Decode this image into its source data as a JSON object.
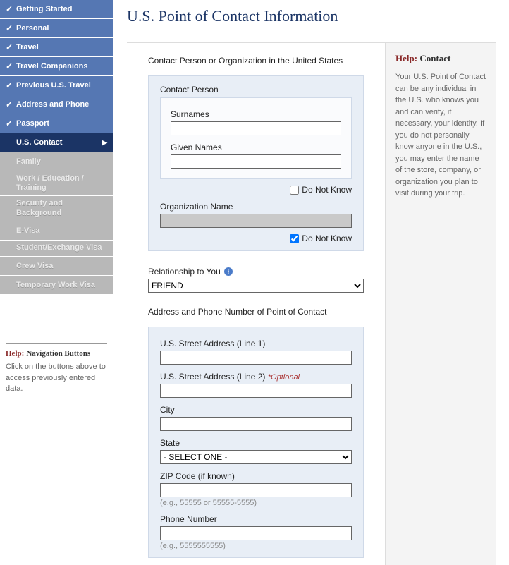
{
  "sidebar": {
    "items": [
      {
        "label": "Getting Started",
        "state": "done"
      },
      {
        "label": "Personal",
        "state": "done"
      },
      {
        "label": "Travel",
        "state": "done"
      },
      {
        "label": "Travel Companions",
        "state": "done"
      },
      {
        "label": "Previous U.S. Travel",
        "state": "done"
      },
      {
        "label": "Address and Phone",
        "state": "done"
      },
      {
        "label": "Passport",
        "state": "done"
      },
      {
        "label": "U.S. Contact",
        "state": "active"
      },
      {
        "label": "Family",
        "state": "future"
      },
      {
        "label": "Work / Education / Training",
        "state": "future"
      },
      {
        "label": "Security and Background",
        "state": "future"
      },
      {
        "label": "E-Visa",
        "state": "future"
      },
      {
        "label": "Student/Exchange Visa",
        "state": "future"
      },
      {
        "label": "Crew Visa",
        "state": "future"
      },
      {
        "label": "Temporary Work Visa",
        "state": "future"
      }
    ]
  },
  "page_title": "U.S. Point of Contact Information",
  "section1_heading": "Contact Person or Organization in the United States",
  "contact_person": {
    "box_title": "Contact Person",
    "surnames_label": "Surnames",
    "surnames_value": "",
    "given_label": "Given Names",
    "given_value": "",
    "dnk_label": "Do Not Know",
    "dnk_checked": false
  },
  "org": {
    "label": "Organization Name",
    "value": "",
    "dnk_label": "Do Not Know",
    "dnk_checked": true
  },
  "relationship": {
    "label": "Relationship to You",
    "value": "FRIEND"
  },
  "section2_heading": "Address and Phone Number of Point of Contact",
  "address": {
    "line1_label": "U.S. Street Address (Line 1)",
    "line1_value": "",
    "line2_label": "U.S. Street Address (Line 2)",
    "line2_optional": "*Optional",
    "line2_value": "",
    "city_label": "City",
    "city_value": "",
    "state_label": "State",
    "state_value": "- SELECT ONE -",
    "zip_label": "ZIP Code (if known)",
    "zip_value": "",
    "zip_hint": "(e.g., 55555 or 55555-5555)",
    "phone_label": "Phone Number",
    "phone_value": "",
    "phone_hint": "(e.g., 5555555555)"
  },
  "left_help": {
    "label": "Help:",
    "topic": "Navigation Buttons",
    "body": "Click on the buttons above to access previously entered data."
  },
  "right_help": {
    "label": "Help:",
    "topic": "Contact",
    "body": "Your U.S. Point of Contact can be any individual in the U.S. who knows you and can verify, if necessary, your identity. If you do not personally know anyone in the U.S., you may enter the name of the store, company, or organization you plan to visit during your trip."
  }
}
